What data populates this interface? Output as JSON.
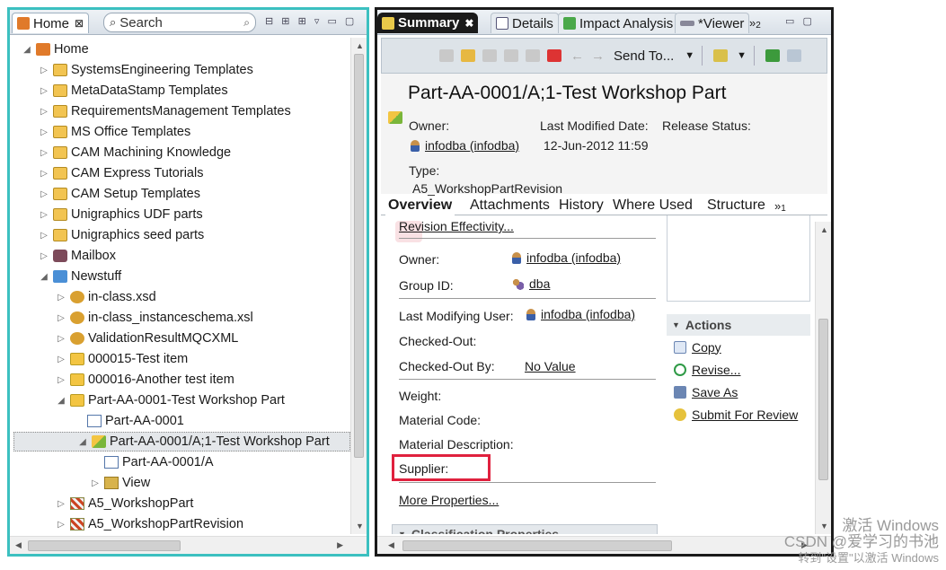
{
  "left_panel": {
    "tab_home": "Home",
    "tab_home_close": "⊠",
    "search_label": "Search",
    "tree": [
      {
        "label": "Home",
        "icon": "home-icon"
      },
      {
        "label": "SystemsEngineering Templates",
        "icon": "folder-icon"
      },
      {
        "label": "MetaDataStamp Templates",
        "icon": "folder-icon"
      },
      {
        "label": "RequirementsManagement Templates",
        "icon": "folder-icon"
      },
      {
        "label": "MS Office Templates",
        "icon": "folder-icon"
      },
      {
        "label": "CAM Machining Knowledge",
        "icon": "folder-icon"
      },
      {
        "label": "CAM Express Tutorials",
        "icon": "folder-icon"
      },
      {
        "label": "CAM Setup Templates",
        "icon": "folder-icon"
      },
      {
        "label": "Unigraphics UDF parts",
        "icon": "folder-icon"
      },
      {
        "label": "Unigraphics seed parts",
        "icon": "folder-icon"
      },
      {
        "label": "Mailbox",
        "icon": "mailbox-icon"
      },
      {
        "label": "Newstuff",
        "icon": "newstuff-folder-icon"
      },
      {
        "label": "in-class.xsd",
        "icon": "dataset-icon"
      },
      {
        "label": "in-class_instanceschema.xsl",
        "icon": "dataset-icon"
      },
      {
        "label": "ValidationResultMQCXML",
        "icon": "dataset-icon"
      },
      {
        "label": "000015-Test item",
        "icon": "item-icon"
      },
      {
        "label": "000016-Another test item",
        "icon": "item-icon"
      },
      {
        "label": "Part-AA-0001-Test Workshop Part",
        "icon": "item-icon"
      },
      {
        "label": "Part-AA-0001",
        "icon": "document-icon"
      },
      {
        "label": "Part-AA-0001/A;1-Test Workshop Part",
        "icon": "revision-icon"
      },
      {
        "label": "Part-AA-0001/A",
        "icon": "document-icon"
      },
      {
        "label": "View",
        "icon": "view-folder-icon"
      },
      {
        "label": "A5_WorkshopPart",
        "icon": "form-icon"
      },
      {
        "label": "A5_WorkshopPartRevision",
        "icon": "form-icon"
      }
    ]
  },
  "right_panel": {
    "tabs": {
      "summary": "Summary",
      "summary_close": "✖",
      "details": "Details",
      "impact": "Impact Analysis",
      "viewer": "*Viewer",
      "overflow": "»",
      "overflow_count": "2"
    },
    "toolbar": {
      "send_to": "Send To...",
      "dropdown": "▼"
    },
    "header": {
      "title": "Part-AA-0001/A;1-Test Workshop Part",
      "owner_label": "Owner:",
      "owner_value": "infodba (infodba)",
      "last_modified_label": "Last Modified Date:",
      "last_modified_value": "12-Jun-2012 11:59",
      "release_status_label": "Release Status:",
      "type_label": "Type:",
      "type_value": "A5_WorkshopPartRevision"
    },
    "subtabs": {
      "overview": "Overview",
      "attachments": "Attachments",
      "history": "History",
      "where_used": "Where Used",
      "structure": "Structure",
      "overflow": "»",
      "overflow_count": "1"
    },
    "overview": {
      "revision_effectivity": "Revision Effectivity...",
      "owner_label": "Owner:",
      "owner_value": "infodba (infodba)",
      "group_label": "Group ID:",
      "group_value": "dba",
      "last_modifying_label": "Last Modifying User:",
      "last_modifying_value": "infodba (infodba)",
      "checked_out_label": "Checked-Out:",
      "checked_out_by_label": "Checked-Out By:",
      "checked_out_by_value": "No Value",
      "weight_label": "Weight:",
      "material_code_label": "Material Code:",
      "material_desc_label": "Material Description:",
      "supplier_label": "Supplier:",
      "more_properties": "More Properties...",
      "classification": "Classification Properties"
    },
    "actions": {
      "title": "Actions",
      "items": [
        "Copy",
        "Revise...",
        "Save As",
        "Submit For Review"
      ]
    }
  },
  "watermark": {
    "line1": "激活 Windows",
    "line2": "CSDN @爱学习的书池",
    "line3": "转到\"设置\"以激活 Windows"
  },
  "colors": {
    "left_focus_border": "#3cc0c0",
    "right_border": "#1a1a1a",
    "highlight": "#e0213e"
  }
}
